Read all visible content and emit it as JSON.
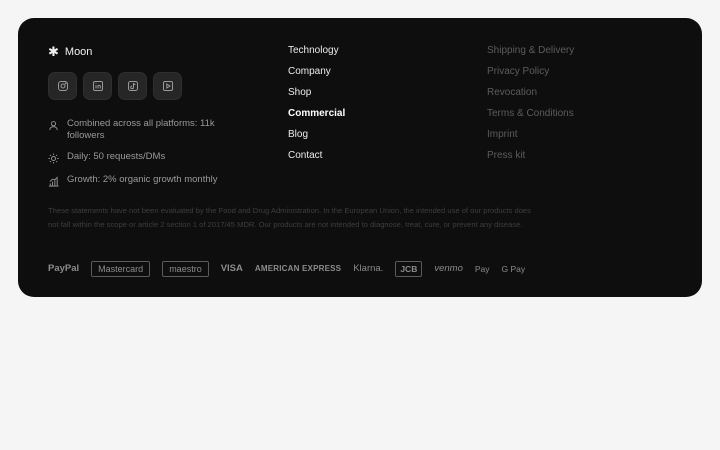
{
  "brand": {
    "icon": "asterisk-icon",
    "name": "Moon"
  },
  "socials": [
    {
      "name": "instagram-icon"
    },
    {
      "name": "linkedin-icon"
    },
    {
      "name": "tiktok-icon"
    },
    {
      "name": "youtube-icon"
    }
  ],
  "stats": [
    {
      "icon": "user-icon",
      "text": "Combined across all platforms: 11k followers"
    },
    {
      "icon": "sun-icon",
      "text": "Daily: 50 requests/DMs"
    },
    {
      "icon": "bar-chart-icon",
      "text": "Growth: 2% organic growth monthly"
    }
  ],
  "nav": {
    "main": [
      "Technology",
      "Company",
      "Shop",
      "Commercial",
      "Blog",
      "Contact"
    ],
    "active": "Commercial",
    "legal": [
      "Shipping & Delivery",
      "Privacy Policy",
      "Revocation",
      "Terms & Conditions",
      "Imprint",
      "Press kit"
    ]
  },
  "disclaimer": "These statements have not been evaluated by the Food and Drug Administration. In the European Union, the intended use of our products does not fall within the scope or article 2 section 1 of 2017/45 MDR. Our products are not intended to diagnose, treat, cure, or prevent any disease.",
  "payments": [
    "PayPal",
    "Mastercard",
    "maestro",
    "VISA",
    "AMERICAN EXPRESS",
    "Klarna.",
    "JCB",
    "venmo",
    "Pay",
    "G Pay"
  ],
  "colors": {
    "panel": "#0e0e0e",
    "page": "#f5f5f5",
    "text_primary": "#ececec",
    "text_muted": "#5c5c5c"
  }
}
